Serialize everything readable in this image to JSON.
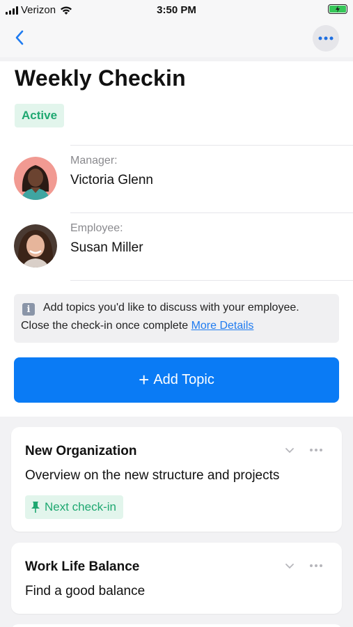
{
  "status_bar": {
    "carrier": "Verizon",
    "time": "3:50 PM"
  },
  "nav": {
    "back_icon": "chevron-left-icon",
    "more_icon": "ellipsis-icon"
  },
  "checkin": {
    "title": "Weekly Checkin",
    "status": "Active",
    "manager": {
      "role": "Manager:",
      "name": "Victoria Glenn"
    },
    "employee": {
      "role": "Employee:",
      "name": "Susan Miller"
    }
  },
  "info": {
    "line1": "Add topics you'd like to discuss with your employee.",
    "line2": "Close the check-in once complete",
    "link": "More Details"
  },
  "add_topic": {
    "plus": "+",
    "label": "Add Topic"
  },
  "topics": [
    {
      "title": "New Organization",
      "description": "Overview on the new structure and projects",
      "badge": "Next check-in"
    },
    {
      "title": "Work Life Balance",
      "description": "Find a good balance"
    }
  ],
  "colors": {
    "accent": "#0a7bf5",
    "active_green": "#1fa871",
    "active_bg": "#e2f5ec",
    "link": "#1f7bf0"
  }
}
